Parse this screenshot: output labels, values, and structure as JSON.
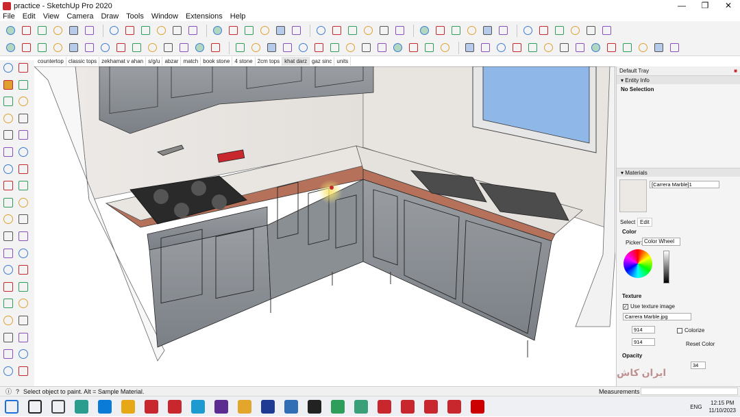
{
  "window": {
    "title": "practice - SketchUp Pro 2020",
    "minimize": "—",
    "maximize": "❐",
    "close": "✕"
  },
  "menu": [
    "File",
    "Edit",
    "View",
    "Camera",
    "Draw",
    "Tools",
    "Window",
    "Extensions",
    "Help"
  ],
  "scenes": [
    "countertop",
    "classic tops",
    "zekhamat v ahan",
    "s/g/u",
    "abzar",
    "match",
    "book stone",
    "4 stone",
    "2cm tops",
    "khat darz",
    "gaz sinc",
    "units"
  ],
  "active_scene": "khat darz",
  "tray": {
    "title": "Default Tray",
    "entity_info": {
      "label": "Entity Info",
      "value": "No Selection"
    },
    "materials": {
      "label": "Materials",
      "name": "[Carrera Marble]1",
      "tabs": [
        "Select",
        "Edit"
      ],
      "color_label": "Color",
      "picker_label": "Picker:",
      "picker_value": "Color Wheel",
      "texture_label": "Texture",
      "use_texture": "Use texture image",
      "texture_file": "Carrera Marble.jpg",
      "width": "914",
      "height": "914",
      "colorize": "Colorize",
      "reset_color": "Reset Color",
      "opacity_label": "Opacity",
      "opacity": "34"
    }
  },
  "watermark": "ایران کاش",
  "status": {
    "message": "Select object to paint. Alt = Sample Material.",
    "measurements": "Measurements"
  },
  "taskbar": {
    "lang": "ENG",
    "time": "12:15 PM",
    "date": "11/10/2023"
  },
  "colors": {
    "accent": "#c8282d",
    "wood": "#8a8f94",
    "counter": "#b5715a",
    "window": "#8fb7e8"
  }
}
